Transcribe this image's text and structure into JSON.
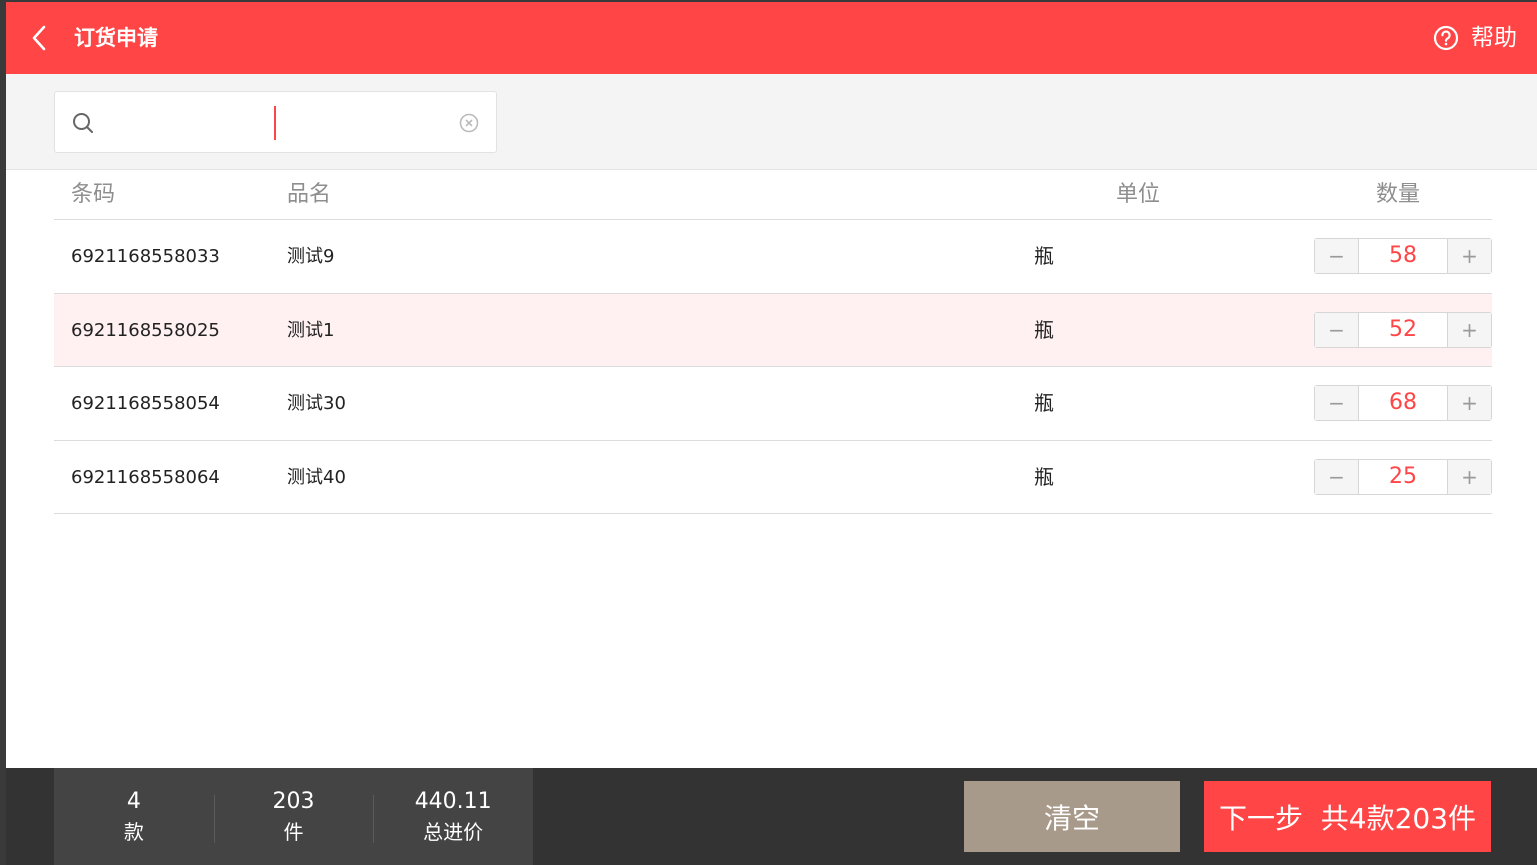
{
  "header": {
    "title": "订货申请",
    "help_label": "帮助"
  },
  "search": {
    "value": "",
    "placeholder": ""
  },
  "table": {
    "columns": [
      "条码",
      "品名",
      "单位",
      "数量"
    ],
    "rows": [
      {
        "barcode": "6921168558033",
        "name": "测试9",
        "unit": "瓶",
        "qty": "58",
        "selected": false
      },
      {
        "barcode": "6921168558025",
        "name": "测试1",
        "unit": "瓶",
        "qty": "52",
        "selected": true
      },
      {
        "barcode": "6921168558054",
        "name": "测试30",
        "unit": "瓶",
        "qty": "68",
        "selected": false
      },
      {
        "barcode": "6921168558064",
        "name": "测试40",
        "unit": "瓶",
        "qty": "25",
        "selected": false
      }
    ]
  },
  "stepper": {
    "minus": "−",
    "plus": "+"
  },
  "footer": {
    "stats": [
      {
        "value": "4",
        "label": "款"
      },
      {
        "value": "203",
        "label": "件"
      },
      {
        "value": "440.11",
        "label": "总进价"
      }
    ],
    "clear_label": "清空",
    "next_label": "下一步  共4款203件"
  },
  "colors": {
    "primary": "#ff4545",
    "selected_row": "#fff1f1",
    "clear_button": "#a89a8a",
    "footer_bg": "#333333"
  }
}
